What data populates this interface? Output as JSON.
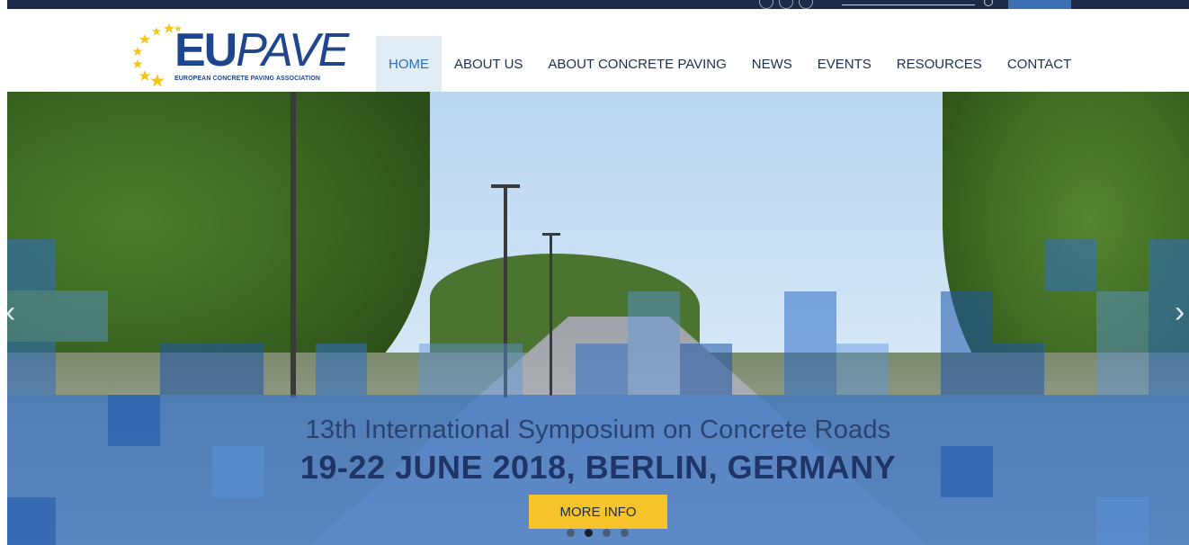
{
  "colors": {
    "topbar": "#1c2a48",
    "brand_blue": "#1f4591",
    "nav_active_bg": "#e2ecf5",
    "nav_active_text": "#2d6fb1",
    "cta_yellow": "#f6c32b",
    "overlay_blue": "#3773c8"
  },
  "logo": {
    "eu": "EU",
    "pave": "PAVE",
    "tagline": "EUROPEAN CONCRETE PAVING ASSOCIATION",
    "icon": "stars-arc-icon"
  },
  "nav": {
    "items": [
      {
        "label": "HOME",
        "active": true
      },
      {
        "label": "ABOUT US"
      },
      {
        "label": "ABOUT CONCRETE PAVING"
      },
      {
        "label": "NEWS"
      },
      {
        "label": "EVENTS"
      },
      {
        "label": "RESOURCES"
      },
      {
        "label": "CONTACT"
      }
    ]
  },
  "hero": {
    "title": "13th International Symposium on Concrete Roads",
    "subtitle": "19-22 JUNE 2018, BERLIN, GERMANY",
    "button": "MORE INFO",
    "slides_total": 4,
    "slide_active": 2,
    "prev_icon": "chevron-left-icon",
    "next_icon": "chevron-right-icon"
  }
}
